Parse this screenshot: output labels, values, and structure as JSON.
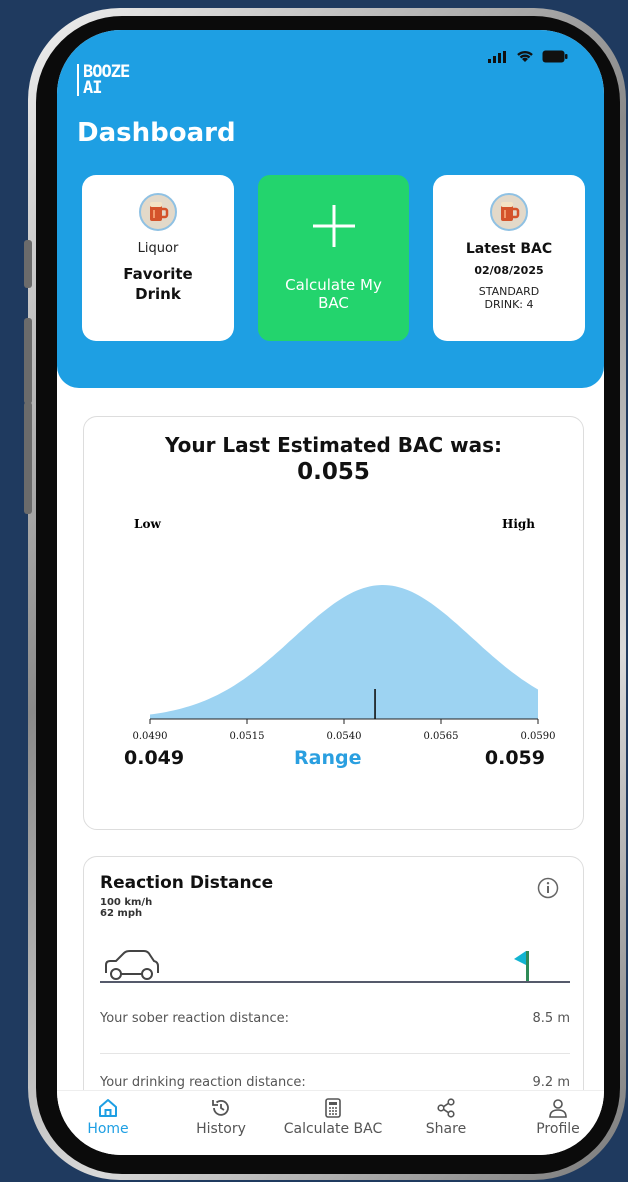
{
  "header": {
    "logo": "BOOZE\nAI",
    "logo_line1": "BOOZE",
    "logo_line2": "AI",
    "title": "Dashboard"
  },
  "cards": {
    "favorite": {
      "sub": "Liquor",
      "main_line1": "Favorite",
      "main_line2": "Drink",
      "icon": "beer-mug-icon"
    },
    "calculate": {
      "label_line1": "Calculate My",
      "label_line2": "BAC",
      "icon": "plus-icon"
    },
    "latest": {
      "title": "Latest BAC",
      "date": "02/08/2025",
      "detail_line1": "STANDARD",
      "detail_line2": "DRINK: 4",
      "icon": "beer-mug-icon"
    }
  },
  "bac_panel": {
    "title": "Your Last Estimated BAC was:",
    "value": "0.055",
    "low_label": "Low",
    "high_label": "High",
    "range_low": "0.049",
    "range_label": "Range",
    "range_high": "0.059"
  },
  "chart_data": {
    "type": "area",
    "x_ticks": [
      "0.0490",
      "0.0515",
      "0.0540",
      "0.0565",
      "0.0590"
    ],
    "xlim": [
      0.049,
      0.059
    ],
    "distribution": {
      "mean": 0.055,
      "sd": 0.0023
    },
    "marker_x": 0.0548,
    "fill_color": "#9dd3f2"
  },
  "reaction": {
    "title": "Reaction Distance",
    "speed_kmh": "100 km/h",
    "speed_mph": "62 mph",
    "rows": [
      {
        "label": "Your sober reaction distance:",
        "value": "8.5 m"
      },
      {
        "label": "Your drinking reaction distance:",
        "value": "9.2 m"
      }
    ]
  },
  "tabs": [
    {
      "label": "Home",
      "icon": "home-icon",
      "active": true
    },
    {
      "label": "History",
      "icon": "history-icon",
      "active": false
    },
    {
      "label": "Calculate BAC",
      "icon": "calculator-icon",
      "active": false
    },
    {
      "label": "Share",
      "icon": "share-icon",
      "active": false
    },
    {
      "label": "Profile",
      "icon": "profile-icon",
      "active": false
    }
  ],
  "colors": {
    "accent": "#1e9fe3",
    "calc_green": "#23d46d",
    "range_blue": "#2a9fe0"
  }
}
